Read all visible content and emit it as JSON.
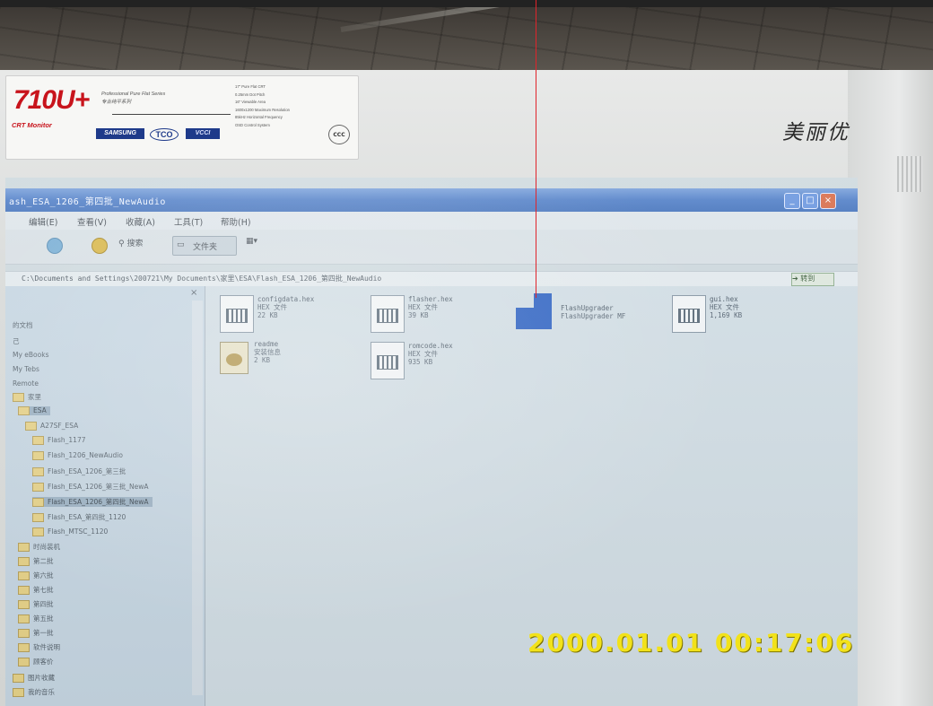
{
  "photo": {
    "timestamp": "2000.01.01  00:17:06",
    "marker_color": "#e0242b"
  },
  "monitor": {
    "model": "710U+",
    "series_text": "Professional Pure Flat Series",
    "series_cn": "专业纯平系列",
    "monitor_type": "CRT Monitor",
    "spec_lines": [
      "17\" Pure Flat CRT",
      "0.25mm Dot Pitch",
      "16\" Viewable Area",
      "1600x1200 Maximum Resolution",
      "85kHz Horizontal Frequency",
      "OSD Control System"
    ],
    "logos": [
      "SAMSUNG",
      "TCO",
      "VCCI"
    ],
    "cert": "CCC",
    "brand": "美丽优"
  },
  "window": {
    "title": "ash_ESA_1206_第四批_NewAudio",
    "menu": [
      "编辑(E)",
      "查看(V)",
      "收藏(A)",
      "工具(T)",
      "帮助(H)"
    ],
    "toolbar": {
      "search_label": "搜索",
      "folders_label": "文件夹"
    },
    "address": "C:\\Documents and Settings\\200721\\My Documents\\家里\\ESA\\Flash_ESA_1206_第四批_NewAudio",
    "go_label": "转到"
  },
  "tree": {
    "items": [
      {
        "label": "的文档",
        "selected": false
      },
      {
        "label": "己",
        "selected": false
      },
      {
        "label": "My eBooks",
        "selected": false
      },
      {
        "label": "My Tebs",
        "selected": false
      },
      {
        "label": "Remote",
        "selected": false
      },
      {
        "label": "家里",
        "selected": false
      },
      {
        "label": "ESA",
        "selected": true
      },
      {
        "label": "A27SF_ESA",
        "selected": false
      },
      {
        "label": "Flash_1177",
        "selected": false
      },
      {
        "label": "Flash_1206_NewAudio",
        "selected": false
      },
      {
        "label": "Flash_ESA_1206_第三批",
        "selected": false
      },
      {
        "label": "Flash_ESA_1206_第三批_NewA",
        "selected": false
      },
      {
        "label": "Flash_ESA_1206_第四批_NewA",
        "selected": true
      },
      {
        "label": "Flash_ESA_第四批_1120",
        "selected": false
      },
      {
        "label": "Flash_MTSC_1120",
        "selected": false
      },
      {
        "label": "时尚装机",
        "selected": false
      },
      {
        "label": "第二批",
        "selected": false
      },
      {
        "label": "第六批",
        "selected": false
      },
      {
        "label": "第七批",
        "selected": false
      },
      {
        "label": "第四批",
        "selected": false
      },
      {
        "label": "第五批",
        "selected": false
      },
      {
        "label": "第一批",
        "selected": false
      },
      {
        "label": "软件说明",
        "selected": false
      },
      {
        "label": "顾客价",
        "selected": false
      },
      {
        "label": "图片收藏",
        "selected": false
      },
      {
        "label": "我的音乐",
        "selected": false
      }
    ]
  },
  "files": [
    {
      "name": "configdata.hex",
      "type": "HEX 文件",
      "size": "22 KB",
      "icon": "hex-file-icon"
    },
    {
      "name": "flasher.hex",
      "type": "HEX 文件",
      "size": "39 KB",
      "icon": "hex-file-icon"
    },
    {
      "name": "FlashUpgrader",
      "type": "FlashUpgrader MF",
      "size": "",
      "icon": "flashupgrader-icon"
    },
    {
      "name": "gui.hex",
      "type": "HEX 文件",
      "size": "1,169 KB",
      "icon": "hex-file-icon"
    },
    {
      "name": "readme",
      "type": "安装信息",
      "size": "2 KB",
      "icon": "setup-info-icon"
    },
    {
      "name": "romcode.hex",
      "type": "HEX 文件",
      "size": "935 KB",
      "icon": "hex-file-icon"
    }
  ]
}
